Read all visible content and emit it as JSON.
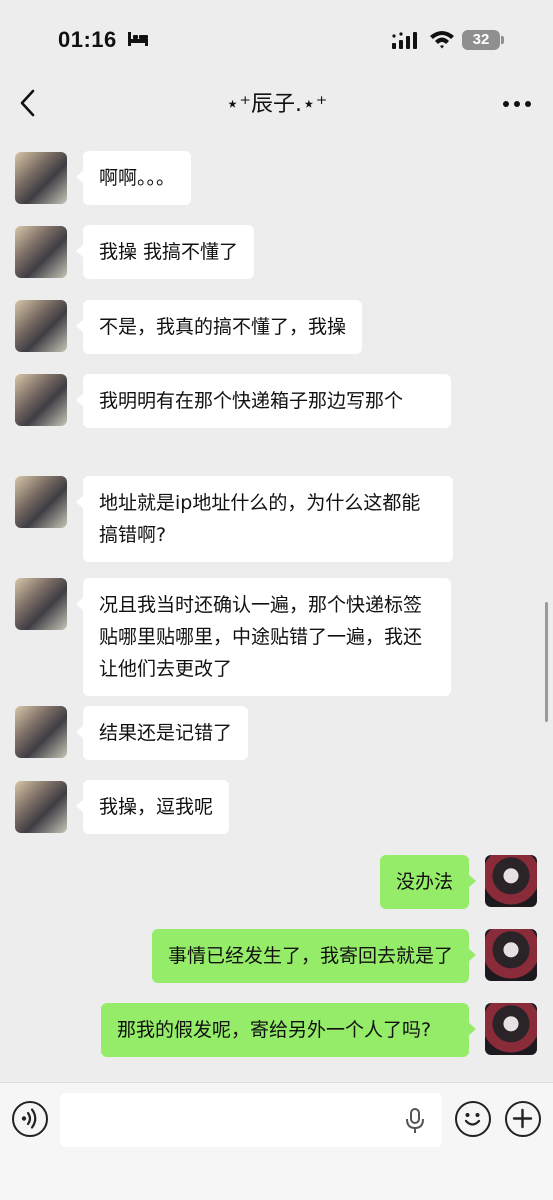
{
  "status_bar": {
    "time": "01:16",
    "battery": "32"
  },
  "header": {
    "title": "⋆⁺辰子.⋆⁺"
  },
  "messages": [
    {
      "side": "left",
      "text": "啊啊。。。"
    },
    {
      "side": "left",
      "text": "我操 我搞不懂了"
    },
    {
      "side": "left",
      "text": "不是，我真的搞不懂了，我操"
    },
    {
      "side": "left",
      "text": "我明明有在那个快递箱子那边写那个"
    },
    {
      "side": "left",
      "text": "地址就是ip地址什么的，为什么这都能搞错啊?"
    },
    {
      "side": "left",
      "text": "况且我当时还确认一遍，那个快递标签贴哪里贴哪里，中途贴错了一遍，我还让他们去更改了"
    },
    {
      "side": "left",
      "text": "结果还是记错了"
    },
    {
      "side": "left",
      "text": "我操，逗我呢"
    },
    {
      "side": "right",
      "text": "没办法"
    },
    {
      "side": "right",
      "text": "事情已经发生了，我寄回去就是了"
    },
    {
      "side": "right",
      "text": "那我的假发呢，寄给另外一个人了吗?"
    }
  ],
  "icons": {
    "back": "chevron-left-icon",
    "more": "ellipsis-icon",
    "voice": "voice-mode-icon",
    "mic": "microphone-icon",
    "emoji": "emoji-icon",
    "plus": "plus-icon"
  },
  "colors": {
    "background": "#ededed",
    "bubble_left": "#ffffff",
    "bubble_right": "#95ec69"
  }
}
